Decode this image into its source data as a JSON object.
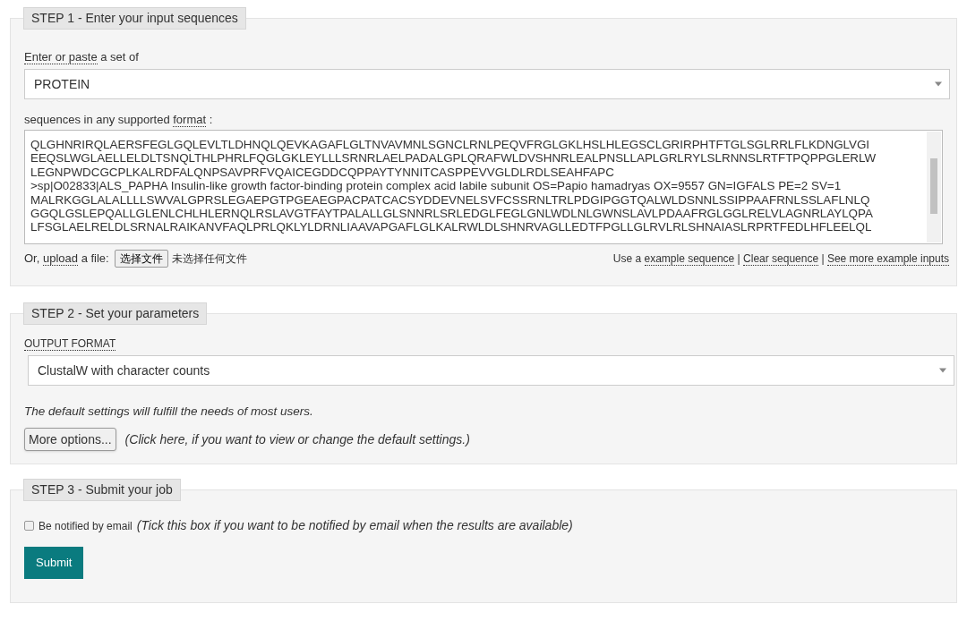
{
  "step1": {
    "legend": "STEP 1 - Enter your input sequences",
    "intro": [
      {
        "text": "Enter or paste",
        "link": true
      },
      {
        "text": "a set of",
        "link": false
      }
    ],
    "sequence_type": {
      "value": "PROTEIN"
    },
    "format_label": [
      {
        "text": "sequences in any supported",
        "link": false
      },
      {
        "text": "format",
        "link": true
      },
      {
        "text": ":",
        "link": false
      }
    ],
    "sequences": [
      "QLGHNRIRQLAERSFEGLGQLEVLTLDHNQLQEVKAGAFLGLTNVAVMNLSGNCLRNLPEQVFRGLGKLHSLHLEGSCLGRIRPHTFTGLSGLRRLFLKDNGLVGI",
      "EEQSLWGLAELLELDLTSNQLTHLPHRLFQGLGKLEYLLLSRNRLAELPADALGPLQRAFWLDVSHNRLEALPNSLLAPLGRLRYLSLRNNSLRTFTPQPPGLERLW",
      "LEGNPWDCGCPLKALRDFALQNPSAVPRFVQAICEGDDCQPPAYTYNNITCASPPEVVGLDLRDLSEAHFAPC",
      ">sp|O02833|ALS_PAPHA Insulin-like growth factor-binding protein complex acid labile subunit OS=Papio hamadryas OX=9557 GN=IGFALS PE=2 SV=1",
      "MALRKGGLALALLLLSWVALGPRSLEGAEPGTPGEAEGPACPATCACSYDDEVNELSVFCSSRNLTRLPDGIPGGTQALWLDSNNLSSIPPAAFRNLSSLAFLNLQ",
      "GGQLGSLEPQALLGLENLCHLHLERNQLRSLAVGTFAYTPALALLGLSNNRLSRLEDGLFEGLGNLWDLNLGWNSLAVLPDAAFRGLGGLRELVLAGNRLAYLQPA",
      "LFSGLAELRELDLSRNALRAIKANVFAQLPRLQKLYLDRNLIAAVAPGAFLGLKALRWLDLSHNRVAGLLEDTFPGLLGLRVLRLSHNAIASLRPRTFEDLHFLEELQL"
    ],
    "upload": [
      {
        "text": "Or,",
        "link": false
      },
      {
        "text": "upload",
        "link": true
      },
      {
        "text": "a file:",
        "link": false
      }
    ],
    "file_button": "选择文件",
    "file_status": "未选择任何文件",
    "actions": [
      {
        "text": "Use a",
        "link": false
      },
      {
        "text": "example sequence",
        "link": true
      },
      {
        "text": "|",
        "link": false
      },
      {
        "text": "Clear sequence",
        "link": true
      },
      {
        "text": "|",
        "link": false
      },
      {
        "text": "See more example inputs",
        "link": true
      }
    ]
  },
  "step2": {
    "legend": "STEP 2 - Set your parameters",
    "output_format_label": "OUTPUT FORMAT",
    "output_format": {
      "value": "ClustalW with character counts"
    },
    "note": "The default settings will fulfill the needs of most users.",
    "more_options": "More options...",
    "more_hint": "(Click here, if you want to view or change the default settings.)"
  },
  "step3": {
    "legend": "STEP 3 - Submit your job",
    "notify": {
      "label": "Be notified by email",
      "checked": false
    },
    "notify_hint": "(Tick this box if you want to be notified by email when the results are available)",
    "submit": "Submit"
  }
}
